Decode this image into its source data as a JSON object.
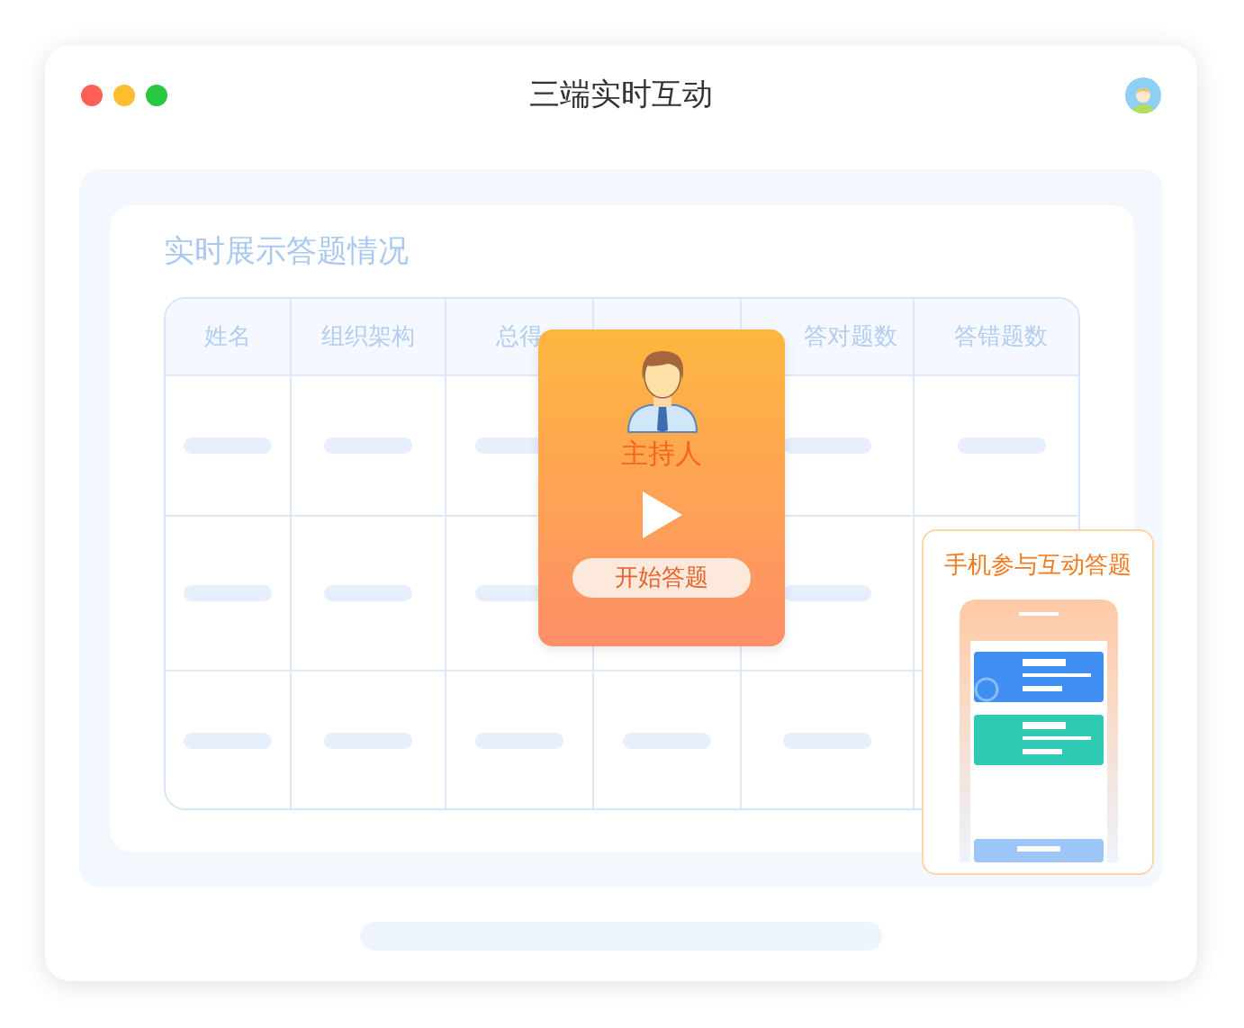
{
  "window": {
    "title": "三端实时互动"
  },
  "board": {
    "heading": "实时展示答题情况"
  },
  "table": {
    "columns": [
      {
        "label": "姓名"
      },
      {
        "label": "组织架构"
      },
      {
        "label": "总得"
      },
      {},
      {
        "label": "答对题数"
      },
      {
        "label": "答错题数"
      }
    ]
  },
  "host_card": {
    "role": "主持人",
    "button": "开始答题"
  },
  "phone_card": {
    "title": "手机参与互动答题"
  }
}
